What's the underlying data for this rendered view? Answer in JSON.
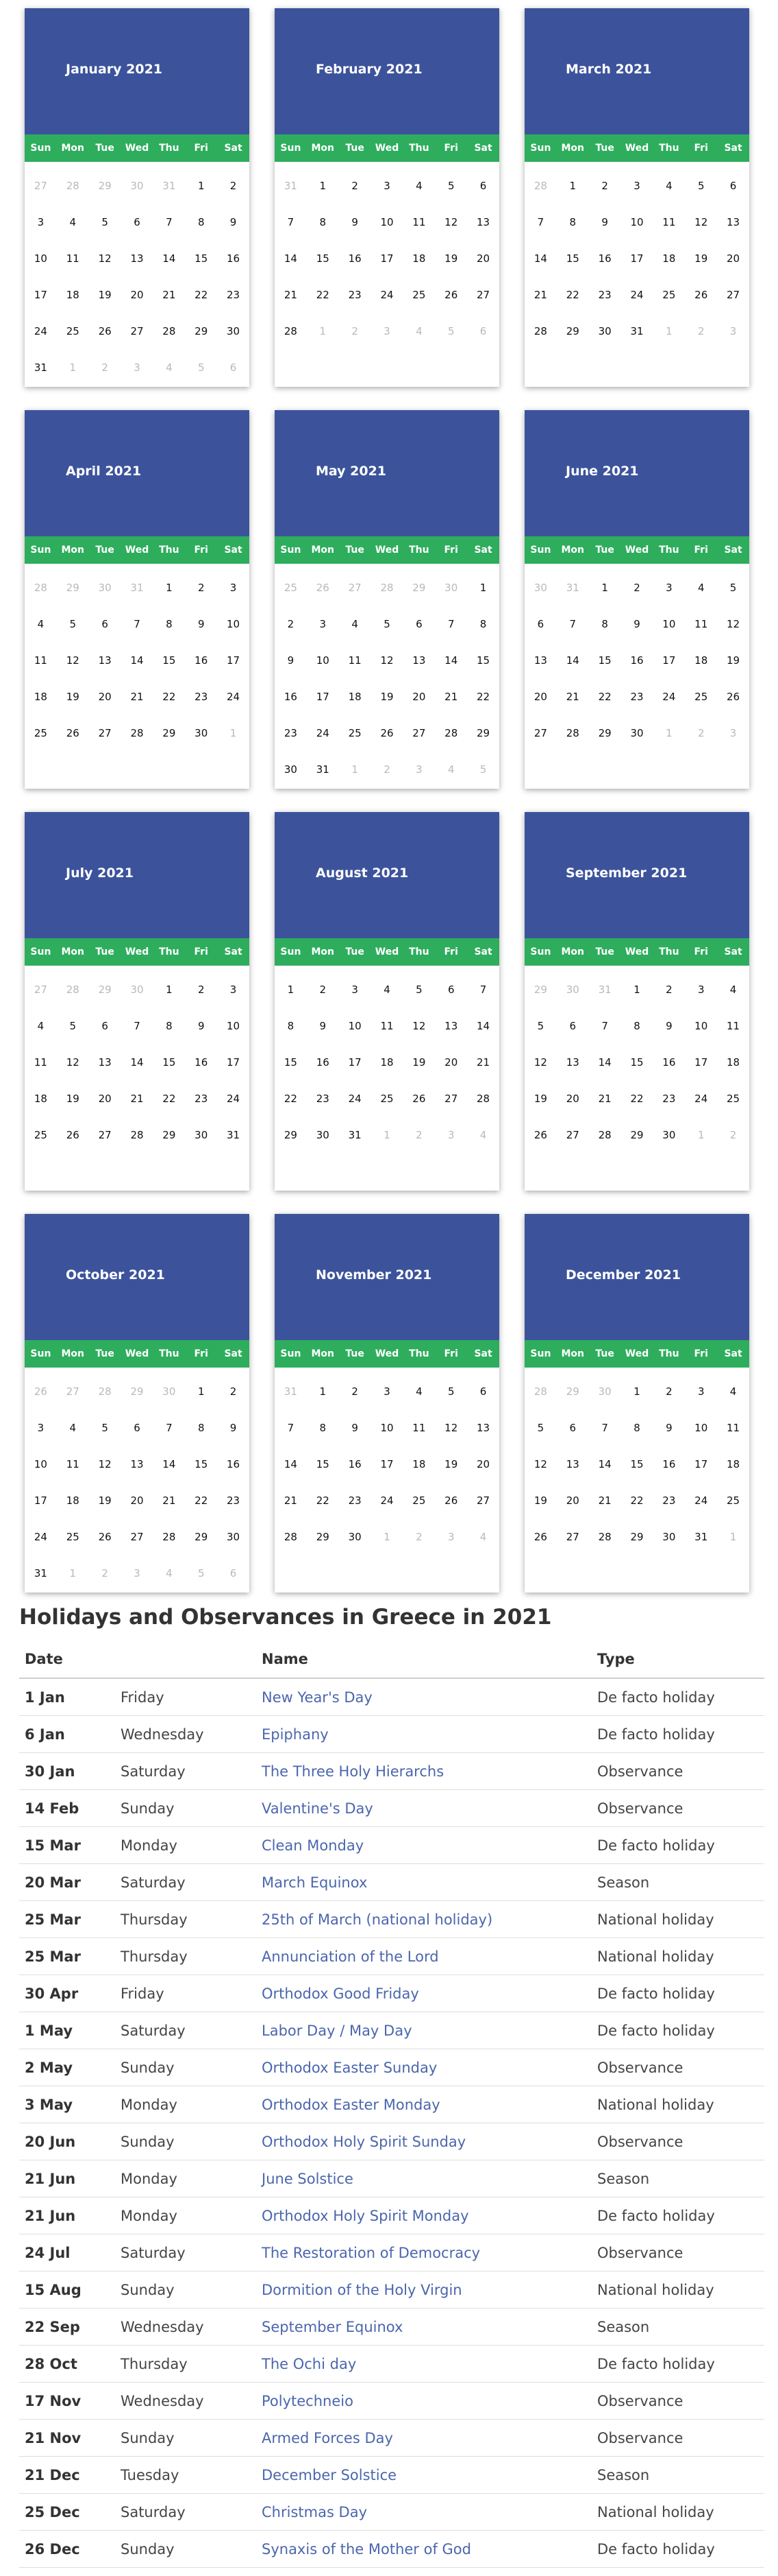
{
  "weekdays": [
    "Sun",
    "Mon",
    "Tue",
    "Wed",
    "Thu",
    "Fri",
    "Sat"
  ],
  "months": [
    {
      "title": "January 2021",
      "lead": [
        27,
        28,
        29,
        30,
        31
      ],
      "count": 31,
      "trail": [
        1,
        2,
        3,
        4,
        5,
        6
      ]
    },
    {
      "title": "February 2021",
      "lead": [
        31
      ],
      "count": 28,
      "trail": [
        1,
        2,
        3,
        4,
        5,
        6
      ]
    },
    {
      "title": "March 2021",
      "lead": [
        28
      ],
      "count": 31,
      "trail": [
        1,
        2,
        3
      ]
    },
    {
      "title": "April 2021",
      "lead": [
        28,
        29,
        30,
        31
      ],
      "count": 30,
      "trail": [
        1
      ]
    },
    {
      "title": "May 2021",
      "lead": [
        25,
        26,
        27,
        28,
        29,
        30
      ],
      "count": 31,
      "trail": [
        1,
        2,
        3,
        4,
        5
      ]
    },
    {
      "title": "June 2021",
      "lead": [
        30,
        31
      ],
      "count": 30,
      "trail": [
        1,
        2,
        3
      ]
    },
    {
      "title": "July 2021",
      "lead": [
        27,
        28,
        29,
        30
      ],
      "count": 31,
      "trail": []
    },
    {
      "title": "August 2021",
      "lead": [],
      "count": 31,
      "trail": [
        1,
        2,
        3,
        4
      ]
    },
    {
      "title": "September 2021",
      "lead": [
        29,
        30,
        31
      ],
      "count": 30,
      "trail": [
        1,
        2
      ]
    },
    {
      "title": "October 2021",
      "lead": [
        26,
        27,
        28,
        29,
        30
      ],
      "count": 31,
      "trail": [
        1,
        2,
        3,
        4,
        5,
        6
      ]
    },
    {
      "title": "November 2021",
      "lead": [
        31
      ],
      "count": 30,
      "trail": [
        1,
        2,
        3,
        4
      ]
    },
    {
      "title": "December 2021",
      "lead": [
        28,
        29,
        30
      ],
      "count": 31,
      "trail": [
        1
      ]
    }
  ],
  "holidays": {
    "title": "Holidays and Observances in Greece in 2021",
    "headers": {
      "date": "Date",
      "name": "Name",
      "type": "Type"
    },
    "rows": [
      {
        "date": "1 Jan",
        "day": "Friday",
        "name": "New Year's Day",
        "type": "De facto holiday"
      },
      {
        "date": "6 Jan",
        "day": "Wednesday",
        "name": "Epiphany",
        "type": "De facto holiday"
      },
      {
        "date": "30 Jan",
        "day": "Saturday",
        "name": "The Three Holy Hierarchs",
        "type": "Observance"
      },
      {
        "date": "14 Feb",
        "day": "Sunday",
        "name": "Valentine's Day",
        "type": "Observance"
      },
      {
        "date": "15 Mar",
        "day": "Monday",
        "name": "Clean Monday",
        "type": "De facto holiday"
      },
      {
        "date": "20 Mar",
        "day": "Saturday",
        "name": "March Equinox",
        "type": "Season"
      },
      {
        "date": "25 Mar",
        "day": "Thursday",
        "name": "25th of March (national holiday)",
        "type": "National holiday"
      },
      {
        "date": "25 Mar",
        "day": "Thursday",
        "name": "Annunciation of the Lord",
        "type": "National holiday"
      },
      {
        "date": "30 Apr",
        "day": "Friday",
        "name": "Orthodox Good Friday",
        "type": "De facto holiday"
      },
      {
        "date": "1 May",
        "day": "Saturday",
        "name": "Labor Day / May Day",
        "type": "De facto holiday"
      },
      {
        "date": "2 May",
        "day": "Sunday",
        "name": "Orthodox Easter Sunday",
        "type": "Observance"
      },
      {
        "date": "3 May",
        "day": "Monday",
        "name": "Orthodox Easter Monday",
        "type": "National holiday"
      },
      {
        "date": "20 Jun",
        "day": "Sunday",
        "name": "Orthodox Holy Spirit Sunday",
        "type": "Observance"
      },
      {
        "date": "21 Jun",
        "day": "Monday",
        "name": "June Solstice",
        "type": "Season"
      },
      {
        "date": "21 Jun",
        "day": "Monday",
        "name": "Orthodox Holy Spirit Monday",
        "type": "De facto holiday"
      },
      {
        "date": "24 Jul",
        "day": "Saturday",
        "name": "The Restoration of Democracy",
        "type": "Observance"
      },
      {
        "date": "15 Aug",
        "day": "Sunday",
        "name": "Dormition of the Holy Virgin",
        "type": "National holiday"
      },
      {
        "date": "22 Sep",
        "day": "Wednesday",
        "name": "September Equinox",
        "type": "Season"
      },
      {
        "date": "28 Oct",
        "day": "Thursday",
        "name": "The Ochi day",
        "type": "De facto holiday"
      },
      {
        "date": "17 Nov",
        "day": "Wednesday",
        "name": "Polytechneio",
        "type": "Observance"
      },
      {
        "date": "21 Nov",
        "day": "Sunday",
        "name": "Armed Forces Day",
        "type": "Observance"
      },
      {
        "date": "21 Dec",
        "day": "Tuesday",
        "name": "December Solstice",
        "type": "Season"
      },
      {
        "date": "25 Dec",
        "day": "Saturday",
        "name": "Christmas Day",
        "type": "National holiday"
      },
      {
        "date": "26 Dec",
        "day": "Sunday",
        "name": "Synaxis of the Mother of God",
        "type": "De facto holiday"
      }
    ]
  }
}
